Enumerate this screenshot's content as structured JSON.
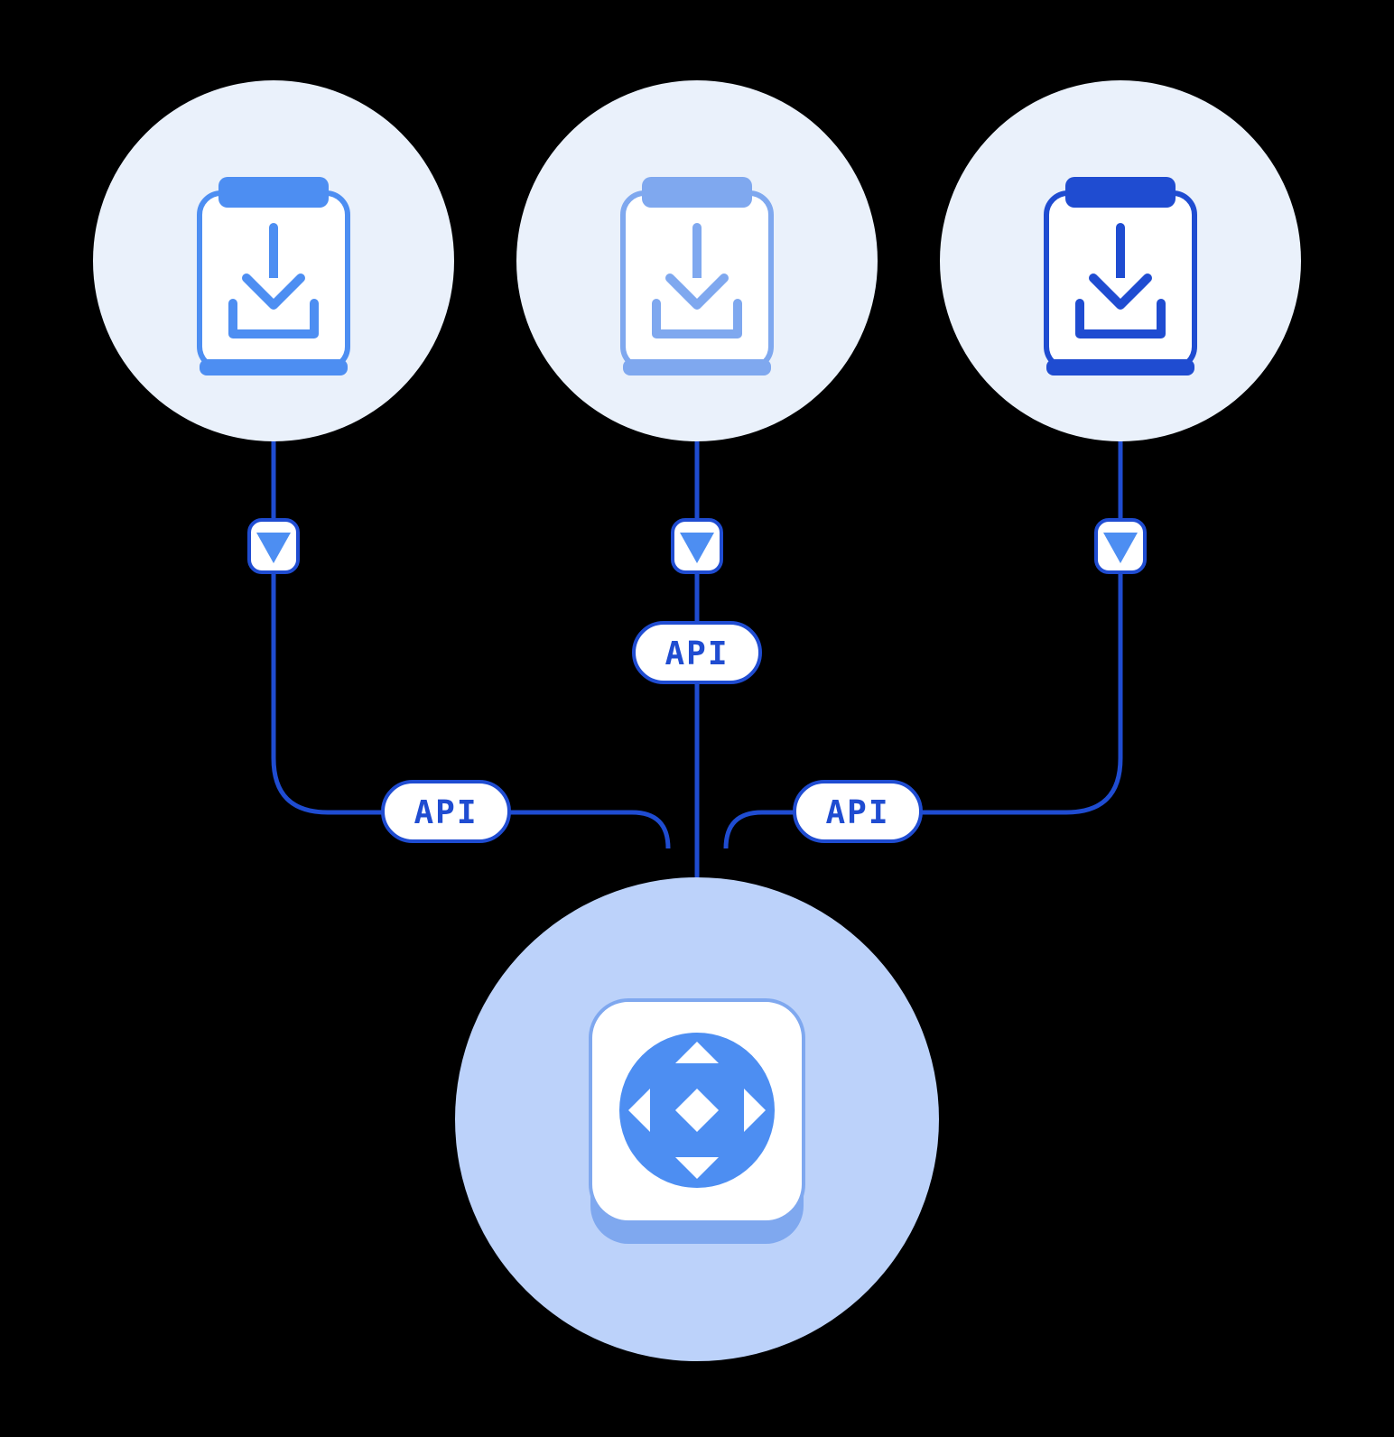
{
  "labels": {
    "api": "API"
  },
  "palette": {
    "bg_circle_light": "#eaf1fb",
    "bg_circle_hub": "#bcd2fa",
    "line": "#1f4cd1",
    "accent_left": "#4d8ef2",
    "accent_mid": "#7fa8ef",
    "accent_right": "#1f4cd1",
    "white": "#ffffff"
  },
  "diagram": {
    "top_nodes": [
      {
        "id": "source-1",
        "icon": "clipboard-download",
        "shade": "light"
      },
      {
        "id": "source-2",
        "icon": "clipboard-download",
        "shade": "mid"
      },
      {
        "id": "source-3",
        "icon": "clipboard-download",
        "shade": "dark"
      }
    ],
    "hub": {
      "id": "hub",
      "icon": "diamond-app"
    },
    "edges": [
      {
        "from": "source-1",
        "to": "hub",
        "label_key": "labels.api"
      },
      {
        "from": "source-2",
        "to": "hub",
        "label_key": "labels.api"
      },
      {
        "from": "source-3",
        "to": "hub",
        "label_key": "labels.api"
      }
    ]
  }
}
